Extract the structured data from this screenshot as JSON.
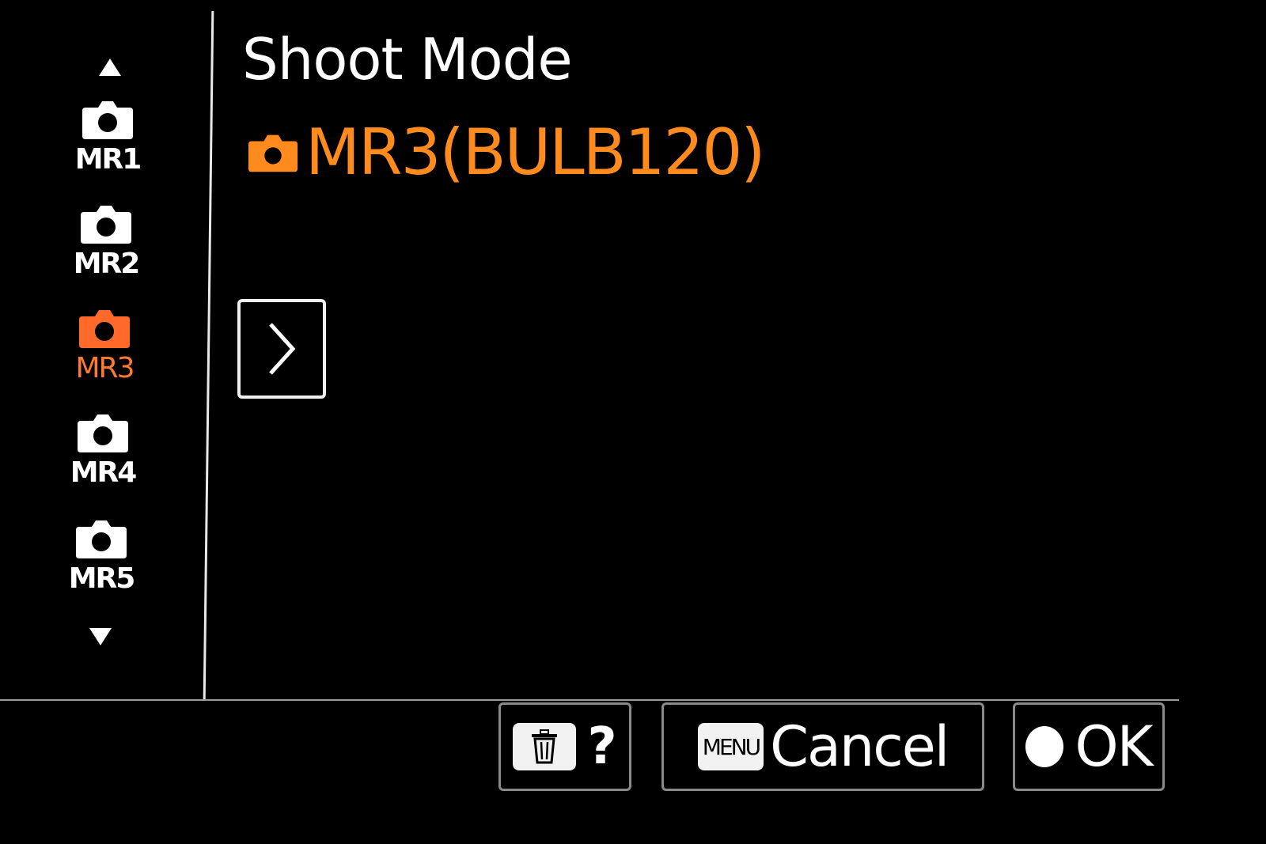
{
  "colors": {
    "background": "#000000",
    "text": "#ffffff",
    "accent_orange": "#ff8a1e",
    "selected_item": "#ff6a2a",
    "border": "#8a8a8a"
  },
  "sidebar": {
    "scroll_up_icon": "triangle-up-icon",
    "scroll_down_icon": "triangle-down-icon",
    "items": [
      {
        "label": "MR1",
        "icon": "camera-icon",
        "selected": false
      },
      {
        "label": "MR2",
        "icon": "camera-icon",
        "selected": false
      },
      {
        "label": "MR3",
        "icon": "camera-icon",
        "selected": true
      },
      {
        "label": "MR4",
        "icon": "camera-icon",
        "selected": false
      },
      {
        "label": "MR5",
        "icon": "camera-icon",
        "selected": false
      }
    ]
  },
  "main": {
    "title": "Shoot Mode",
    "current_mode": {
      "icon": "camera-icon",
      "text": "MR3(BULB120)"
    },
    "next_icon": "chevron-right-icon"
  },
  "footer": {
    "delete_button": {
      "icon": "trash-icon",
      "label": "?"
    },
    "cancel_button": {
      "key": "MENU",
      "label": "Cancel"
    },
    "ok_button": {
      "icon": "filled-circle-icon",
      "label": "OK"
    }
  }
}
